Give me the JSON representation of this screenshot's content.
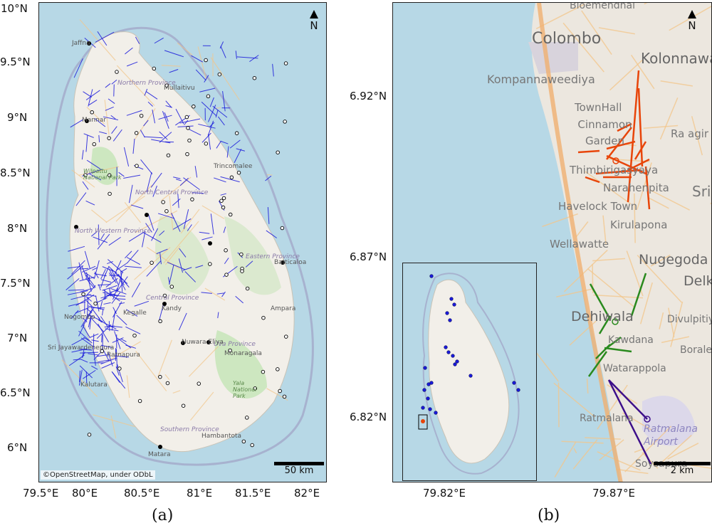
{
  "panel_a": {
    "caption": "(a)",
    "y_ticks": [
      "10°N",
      "9.5°N",
      "9°N",
      "8.5°N",
      "8°N",
      "7.5°N",
      "7°N",
      "6.5°N",
      "6°N"
    ],
    "x_ticks": [
      "79.5°E",
      "80°E",
      "80.5°E",
      "81°E",
      "81.5°E",
      "82°E"
    ],
    "north_label": "N",
    "scale_label": "50 km",
    "attribution": "©OpenStreetMap, under ODbL",
    "place_labels": [
      "Jaffna",
      "Mullaitivu",
      "Northern Province",
      "Mannar",
      "Trincomalee",
      "Wilpattu National Park",
      "North Central Province",
      "Batticaloa",
      "North Western Province",
      "Eastern Province",
      "Central Province",
      "Negombo",
      "Kegalle",
      "Kandy",
      "Ampara",
      "Sri Jayawardenepura",
      "Uva Province",
      "Monaragala",
      "Ratnapura",
      "Kalutara",
      "Yala National Park",
      "Southern Province",
      "Hambantota",
      "Matara",
      "Nuwara Eliya"
    ]
  },
  "panel_b": {
    "caption": "(b)",
    "y_ticks": [
      "6.92°N",
      "6.87°N",
      "6.82°N"
    ],
    "x_ticks": [
      "79.82°E",
      "79.87°E"
    ],
    "north_label": "N",
    "scale_label": "2 km",
    "place_labels": [
      "Bloemendhal",
      "Colombo",
      "Kolonnawa",
      "Kompannaweediya",
      "TownHall",
      "Cinnamon Garden",
      "Ra agir",
      "Thimbirigasyaya",
      "Narahenpita",
      "Havelock Town",
      "Sri",
      "Kirulapona",
      "Wellawatte",
      "Nugegoda",
      "Delk",
      "Dehiwala",
      "Divulpitiy",
      "Kawdana",
      "Borale",
      "Watarappola",
      "Ratmalana",
      "Ratmalana Airport",
      "Soysapura"
    ]
  },
  "colors": {
    "sea": "#b7d8e6",
    "land": "#f2efe9",
    "park": "#cde7c0",
    "road": "#f3c68a",
    "segments_a": "#1a1adb",
    "segments_b_red": "#e8450a",
    "segments_b_green": "#2a8a1e",
    "segments_b_purple": "#3d0f8a"
  }
}
